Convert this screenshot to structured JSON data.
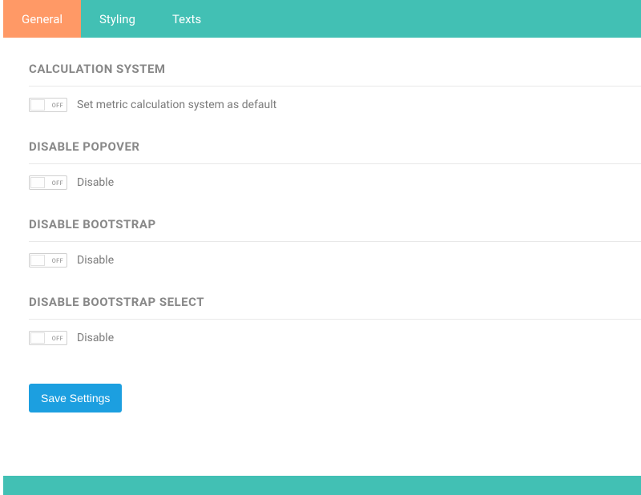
{
  "tabs": {
    "general": "General",
    "styling": "Styling",
    "texts": "Texts"
  },
  "sections": {
    "calc": {
      "title": "CALCULATION SYSTEM",
      "toggle_state": "OFF",
      "desc": "Set metric calculation system as default"
    },
    "popover": {
      "title": "DISABLE POPOVER",
      "toggle_state": "OFF",
      "desc": "Disable"
    },
    "bootstrap": {
      "title": "DISABLE BOOTSTRAP",
      "toggle_state": "OFF",
      "desc": "Disable"
    },
    "bootstrap_select": {
      "title": "DISABLE BOOTSTRAP SELECT",
      "toggle_state": "OFF",
      "desc": "Disable"
    }
  },
  "buttons": {
    "save": "Save Settings"
  }
}
